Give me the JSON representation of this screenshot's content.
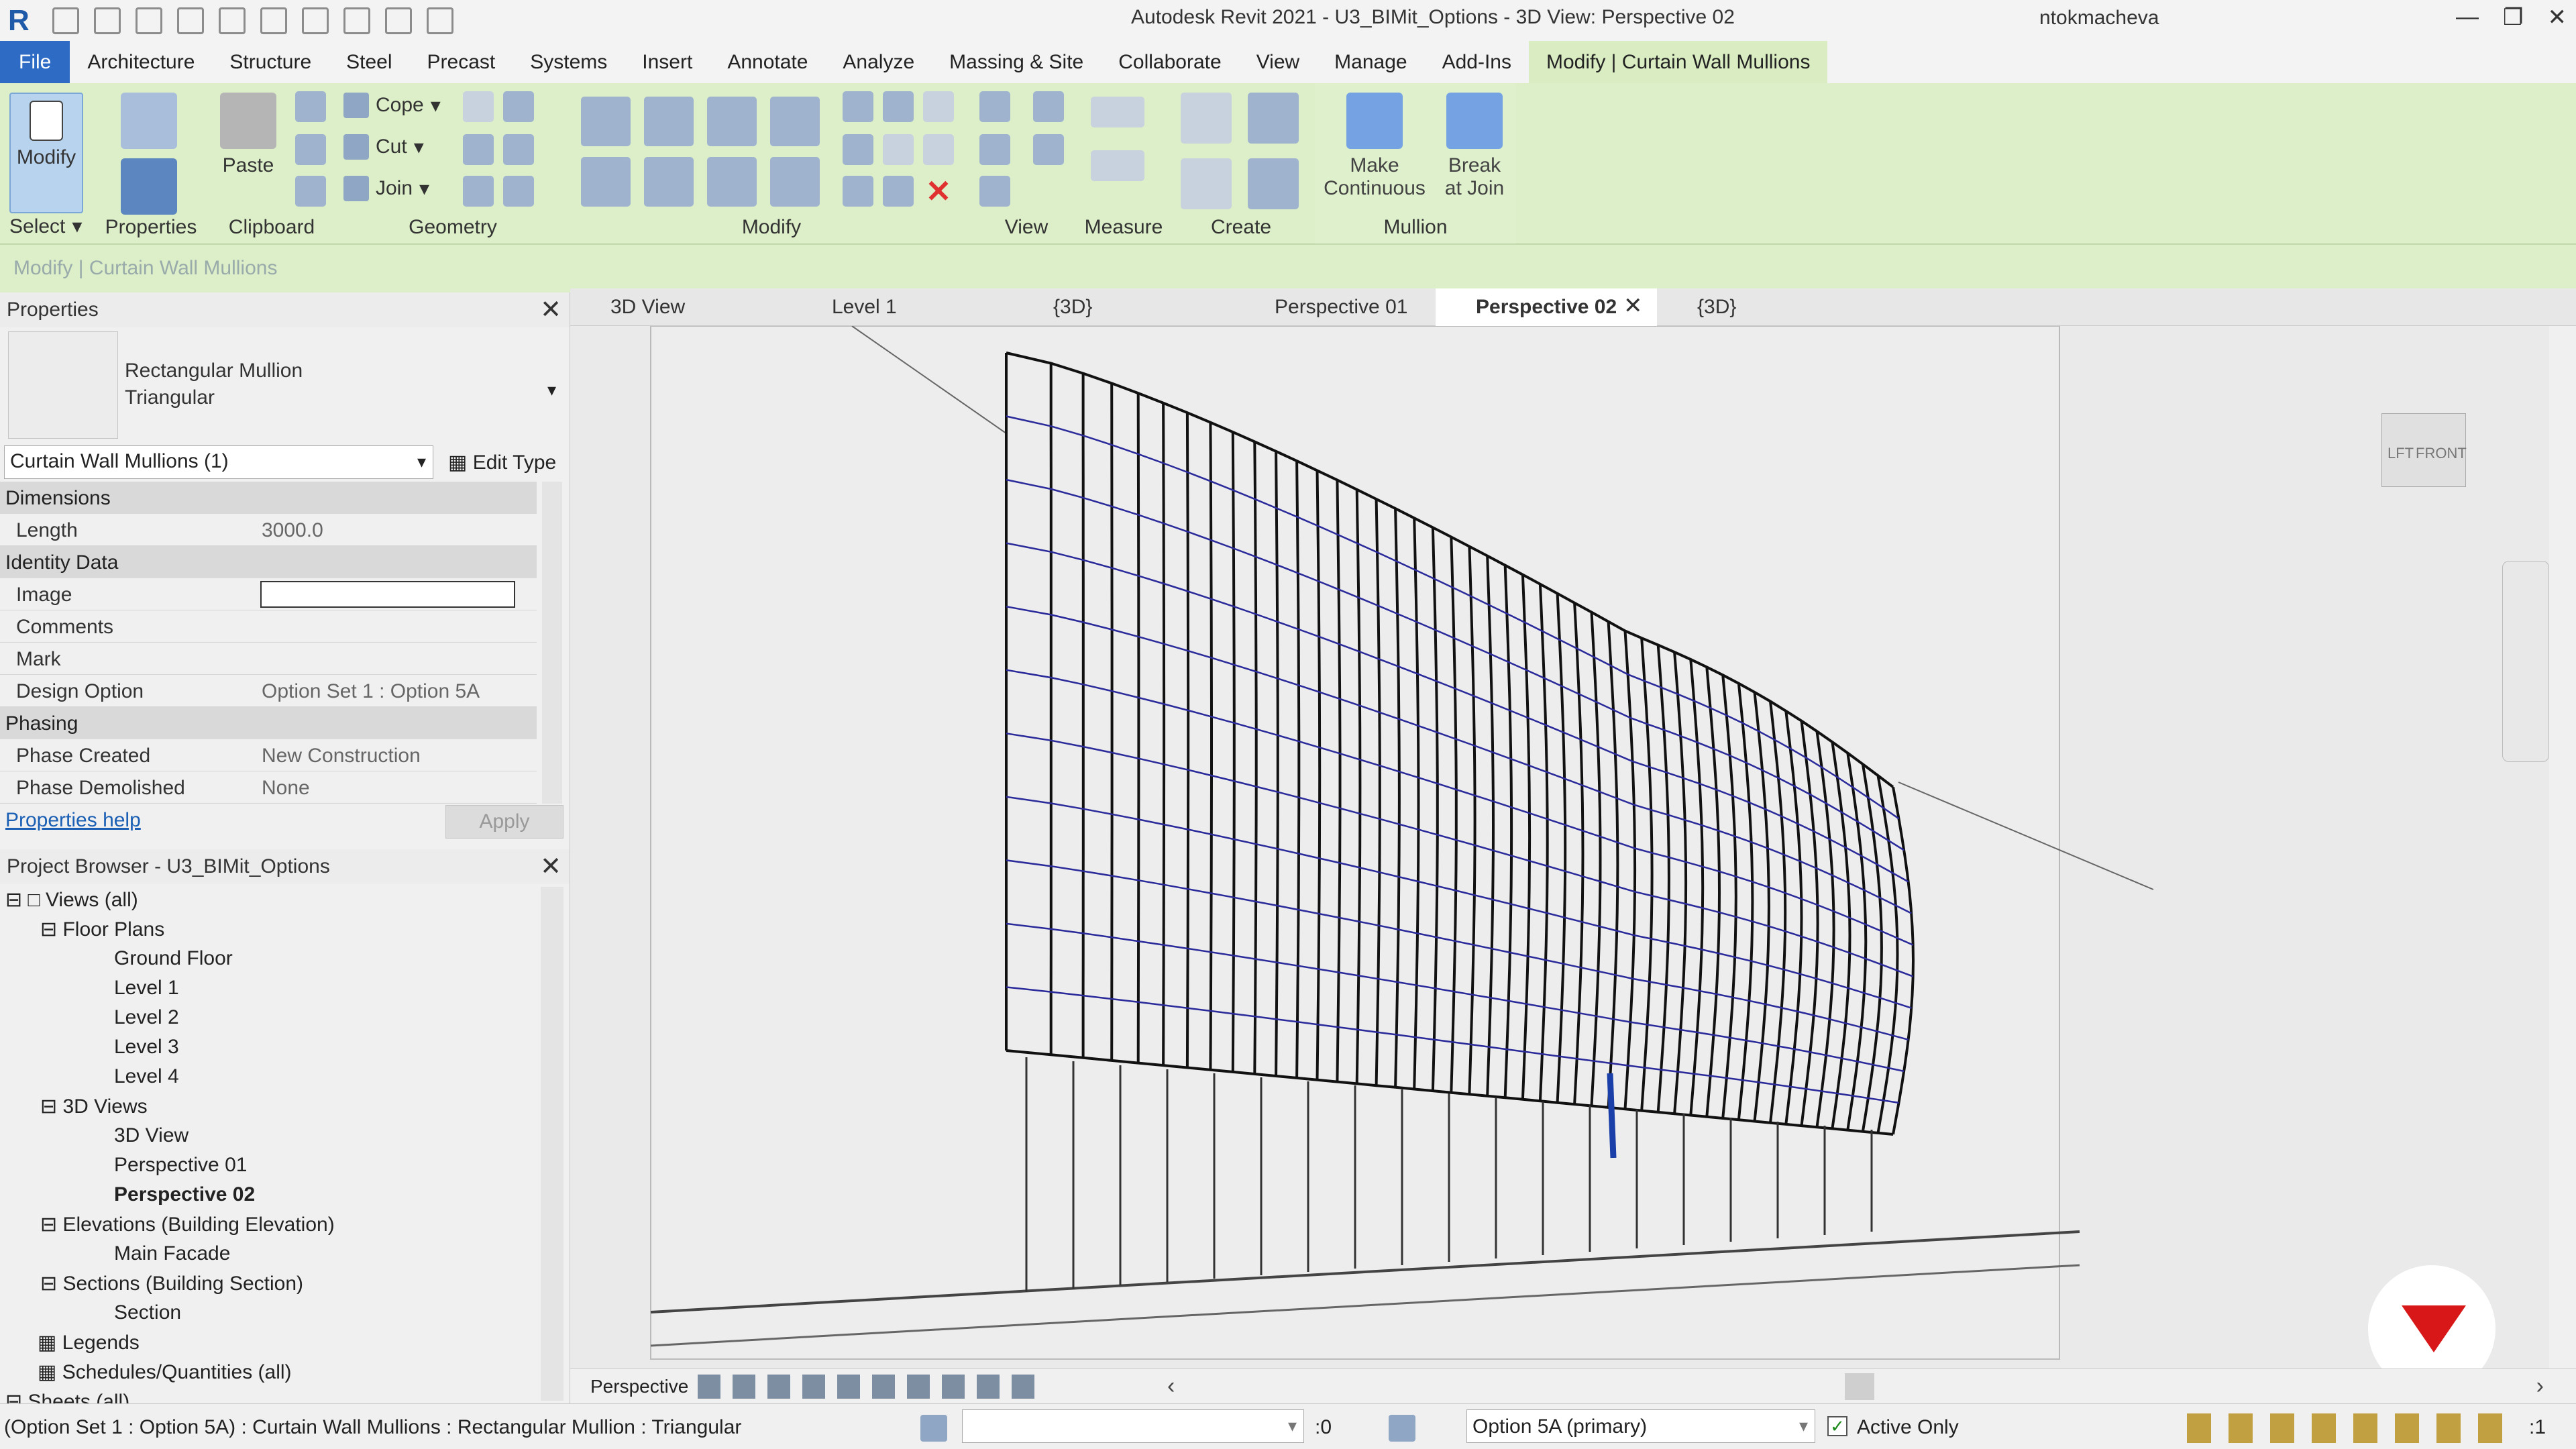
{
  "app": {
    "title": "Autodesk Revit 2021 - U3_BIMit_Options - 3D View: Perspective 02",
    "user": "ntokmacheva",
    "logo_letter": "R"
  },
  "menu": [
    "File",
    "Architecture",
    "Structure",
    "Steel",
    "Precast",
    "Systems",
    "Insert",
    "Annotate",
    "Analyze",
    "Massing & Site",
    "Collaborate",
    "View",
    "Manage",
    "Add-Ins",
    "Modify | Curtain Wall Mullions"
  ],
  "ribbon": {
    "modify_label": "Modify",
    "select_label": "Select",
    "groups": [
      "Properties",
      "Clipboard",
      "Geometry",
      "Modify",
      "View",
      "Measure",
      "Create",
      "Mullion"
    ],
    "paste_label": "Paste",
    "cope_label": "Cope",
    "cut_label": "Cut",
    "join_label": "Join",
    "make_continuous_line1": "Make",
    "make_continuous_line2": "Continuous",
    "break_at_join_line1": "Break",
    "break_at_join_line2": "at Join"
  },
  "option_bar": "Modify | Curtain Wall Mullions",
  "properties": {
    "header": "Properties",
    "type_line1": "Rectangular Mullion",
    "type_line2": "Triangular",
    "filter": "Curtain Wall Mullions (1)",
    "edit_type": "Edit Type",
    "sections": {
      "dimensions": "Dimensions",
      "identity": "Identity Data",
      "phasing": "Phasing"
    },
    "rows": {
      "length_k": "Length",
      "length_v": "3000.0",
      "image_k": "Image",
      "comments_k": "Comments",
      "mark_k": "Mark",
      "design_k": "Design Option",
      "design_v": "Option Set 1 : Option 5A",
      "phase_created_k": "Phase Created",
      "phase_created_v": "New Construction",
      "phase_demolished_k": "Phase Demolished",
      "phase_demolished_v": "None"
    },
    "help_link": "Properties help",
    "apply": "Apply"
  },
  "browser": {
    "header": "Project Browser - U3_BIMit_Options",
    "items": [
      {
        "label": "Views (all)"
      },
      {
        "label": "Floor Plans"
      },
      {
        "label": "Ground Floor"
      },
      {
        "label": "Level 1"
      },
      {
        "label": "Level 2"
      },
      {
        "label": "Level 3"
      },
      {
        "label": "Level 4"
      },
      {
        "label": "3D Views"
      },
      {
        "label": "3D View"
      },
      {
        "label": "Perspective 01"
      },
      {
        "label": "Perspective 02"
      },
      {
        "label": "Elevations (Building Elevation)"
      },
      {
        "label": "Main Facade"
      },
      {
        "label": "Sections (Building Section)"
      },
      {
        "label": "Section"
      },
      {
        "label": "Legends"
      },
      {
        "label": "Schedules/Quantities (all)"
      },
      {
        "label": "Sheets (all)"
      }
    ]
  },
  "view_tabs": [
    "3D View",
    "Level 1",
    "{3D}",
    "Perspective 01",
    "Perspective 02",
    "{3D}"
  ],
  "viewcube": {
    "left": "LFT",
    "front": "FRONT"
  },
  "view_control": {
    "mode": "Perspective"
  },
  "status": {
    "text": "(Option Set 1 : Option 5A) : Curtain Wall Mullions : Rectangular Mullion : Triangular",
    "zero": ":0",
    "design_option": "Option 5A (primary)",
    "active_only": "Active Only",
    "filter_count": ":1"
  },
  "colors": {
    "file_tab": "#2e6bc4",
    "ribbon_bg": "#dcefc8",
    "selection": "#1a3fa8",
    "logo": "#1e5aa8"
  }
}
